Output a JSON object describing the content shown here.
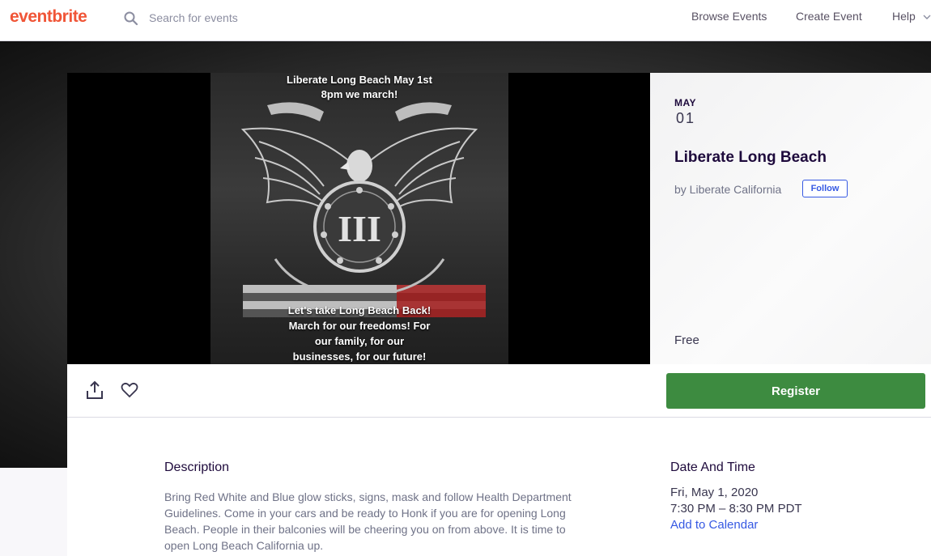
{
  "header": {
    "logo": "eventbrite",
    "search_placeholder": "Search for events",
    "nav": [
      "Browse Events",
      "Create Event",
      "Help"
    ]
  },
  "poster": {
    "top_text": [
      "Liberate Long Beach May 1st",
      "8pm we march!"
    ],
    "bottom_text": [
      "Let's take Long Beach Back!",
      "March for our freedoms! For",
      "our family, for our",
      "businesses, for our future!"
    ]
  },
  "event": {
    "month": "MAY",
    "day": "01",
    "title": "Liberate Long Beach",
    "organizer": "by Liberate California",
    "follow_label": "Follow",
    "price": "Free"
  },
  "actions": {
    "register_label": "Register"
  },
  "details": {
    "description_heading": "Description",
    "description_text": "Bring Red White and Blue glow sticks, signs, mask and follow Health Department Guidelines. Come in your cars and be ready to Honk if you are for opening Long Beach. People in their balconies will be cheering you on from above. It is time to open Long Beach California up.",
    "date_heading": "Date And Time",
    "date": "Fri, May 1, 2020",
    "time": "7:30 PM – 8:30 PM PDT",
    "calendar_link": "Add to Calendar"
  },
  "colors": {
    "brand": "#f05537",
    "register": "#3d8b40",
    "link": "#3659e3"
  }
}
